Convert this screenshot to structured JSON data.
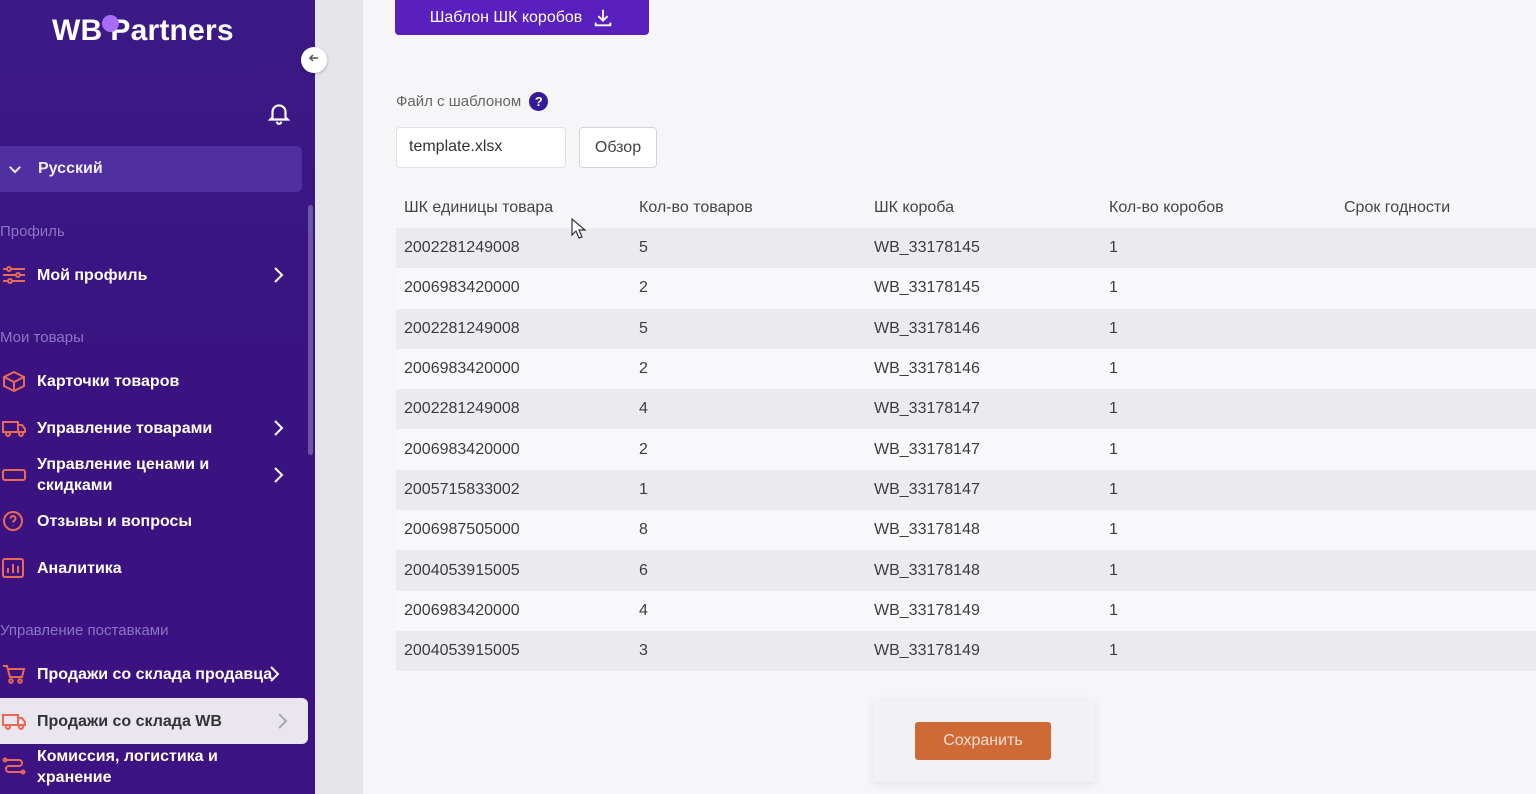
{
  "sidebar": {
    "logo": {
      "part1": "WB",
      "part2": "Partners"
    },
    "language": "Русский",
    "sections": {
      "profile": "Профиль",
      "goods": "Мои товары",
      "supplies": "Управление поставками"
    },
    "items": [
      {
        "label": "Мой профиль",
        "icon": "sliders-icon",
        "arrow": true
      },
      {
        "label": "Карточки товаров",
        "icon": "box-icon",
        "arrow": false
      },
      {
        "label": "Управление товарами",
        "icon": "truck-icon",
        "arrow": true
      },
      {
        "label": "Управление ценами и скидками",
        "icon": "ticket-icon",
        "arrow": true
      },
      {
        "label": "Отзывы и вопросы",
        "icon": "question-circle-icon",
        "arrow": false
      },
      {
        "label": "Аналитика",
        "icon": "chart-icon",
        "arrow": false
      },
      {
        "label": "Продажи со склада продавца",
        "icon": "cart-icon",
        "arrow": true
      },
      {
        "label": "Продажи со склада WB",
        "icon": "truck-icon",
        "arrow": true,
        "active": true
      },
      {
        "label": "Комиссия, логистика и хранение",
        "icon": "route-icon",
        "arrow": false
      }
    ]
  },
  "main": {
    "template_button": "Шаблон ШК коробов",
    "file_label": "Файл с шаблоном",
    "help": "?",
    "file_value": "template.xlsx",
    "browse": "Обзор",
    "save": "Сохранить"
  },
  "table": {
    "headers": [
      "ШК единицы товара",
      "Кол-во товаров",
      "ШК короба",
      "Кол-во коробов",
      "Срок годности"
    ],
    "rows": [
      [
        "2002281249008",
        "5",
        "WB_33178145",
        "1",
        ""
      ],
      [
        "2006983420000",
        "2",
        "WB_33178145",
        "1",
        ""
      ],
      [
        "2002281249008",
        "5",
        "WB_33178146",
        "1",
        ""
      ],
      [
        "2006983420000",
        "2",
        "WB_33178146",
        "1",
        ""
      ],
      [
        "2002281249008",
        "4",
        "WB_33178147",
        "1",
        ""
      ],
      [
        "2006983420000",
        "2",
        "WB_33178147",
        "1",
        ""
      ],
      [
        "2005715833002",
        "1",
        "WB_33178147",
        "1",
        ""
      ],
      [
        "2006987505000",
        "8",
        "WB_33178148",
        "1",
        ""
      ],
      [
        "2004053915005",
        "6",
        "WB_33178148",
        "1",
        ""
      ],
      [
        "2006983420000",
        "4",
        "WB_33178149",
        "1",
        ""
      ],
      [
        "2004053915005",
        "3",
        "WB_33178149",
        "1",
        ""
      ]
    ]
  }
}
